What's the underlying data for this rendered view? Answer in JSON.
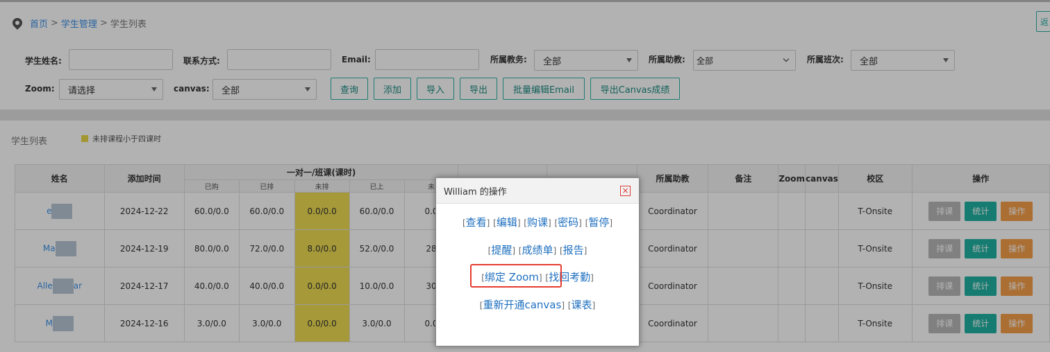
{
  "breadcrumb": {
    "home": "首页",
    "section": "学生管理",
    "current": "学生列表",
    "sep": ">"
  },
  "back_label": "返",
  "filters": {
    "student_name_label": "学生姓名:",
    "contact_label": "联系方式:",
    "email_label": "Email:",
    "teacher_label": "所属教务:",
    "teacher_value": "全部",
    "assistant_label": "所属助教:",
    "assistant_value": "全部",
    "class_label": "所属班次:",
    "class_value": "全部",
    "zoom_label": "Zoom:",
    "zoom_value": "请选择",
    "canvas_label": "canvas:",
    "canvas_value": "全部"
  },
  "buttons": {
    "query": "查询",
    "add": "添加",
    "import": "导入",
    "export": "导出",
    "batch_email": "批量编辑Email",
    "export_canvas": "导出Canvas成绩"
  },
  "list": {
    "title": "学生列表",
    "legend": "未排课程小于四课时"
  },
  "table": {
    "headers": {
      "name": "姓名",
      "added": "添加时间",
      "group": "一对一/班课(课时)",
      "assistant": "所属助教",
      "remark": "备注",
      "zoom": "Zoom",
      "canvas": "canvas",
      "campus": "校区",
      "ops": "操作"
    },
    "subheaders": [
      "已购",
      "已排",
      "未排",
      "已上",
      "未"
    ],
    "rows": [
      {
        "name": "e",
        "date": "2024-12-22",
        "bought": "60.0/0.0",
        "scheduled": "60.0/0.0",
        "unscheduled": "0.0/0.0",
        "attended": "60.0/0.0",
        "remaining": "0.0",
        "assistant": "Coordinator",
        "campus": "T-Onsite"
      },
      {
        "name": "Ma",
        "date": "2024-12-19",
        "bought": "80.0/0.0",
        "scheduled": "72.0/0.0",
        "unscheduled": "8.0/0.0",
        "attended": "52.0/0.0",
        "remaining": "28",
        "assistant": "Coordinator",
        "campus": "T-Onsite"
      },
      {
        "name": "Alle",
        "name_tail": "ar",
        "date": "2024-12-17",
        "bought": "40.0/0.0",
        "scheduled": "40.0/0.0",
        "unscheduled": "0.0/0.0",
        "attended": "10.0/0.0",
        "remaining": "30",
        "assistant": "Coordinator",
        "campus": "T-Onsite"
      },
      {
        "name": "M",
        "date": "2024-12-16",
        "bought": "3.0/0.0",
        "scheduled": "3.0/0.0",
        "unscheduled": "0.0/0.0",
        "attended": "3.0/0.0",
        "remaining": "0.0",
        "assistant": "Coordinator",
        "campus": "T-Onsite"
      }
    ],
    "op_labels": {
      "schedule": "排课",
      "stats": "统计",
      "ops": "操作"
    }
  },
  "modal": {
    "title": "William 的操作",
    "close": "×",
    "links": {
      "view": "查看",
      "edit": "编辑",
      "buy": "购课",
      "password": "密码",
      "pause": "暂停",
      "remind": "提醒",
      "report_card": "成绩单",
      "report": "报告",
      "bind_zoom": "绑定 Zoom",
      "recover_attendance": "找回考勤",
      "reopen_canvas": "重新开通canvas",
      "timetable": "课表"
    }
  }
}
